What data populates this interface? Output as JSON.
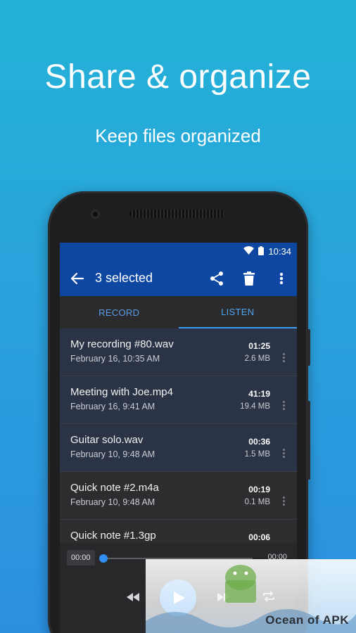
{
  "promo": {
    "headline": "Share & organize",
    "subline": "Keep files organized"
  },
  "status_bar": {
    "time": "10:34",
    "icons": [
      "wifi-icon",
      "battery-icon"
    ]
  },
  "toolbar": {
    "back_icon": "arrow-left-icon",
    "title": "3 selected",
    "actions": [
      "share-icon",
      "delete-icon",
      "more-vertical-icon"
    ]
  },
  "tabs": [
    {
      "label": "RECORD",
      "active": false
    },
    {
      "label": "LISTEN",
      "active": true
    }
  ],
  "recordings": [
    {
      "name": "My recording #80.wav",
      "date": "February 16, 10:35 AM",
      "duration": "01:25",
      "size": "2.6 MB",
      "selected": true
    },
    {
      "name": "Meeting with Joe.mp4",
      "date": "February 16, 9:41 AM",
      "duration": "41:19",
      "size": "19.4 MB",
      "selected": true
    },
    {
      "name": "Guitar solo.wav",
      "date": "February 10, 9:48 AM",
      "duration": "00:36",
      "size": "1.5 MB",
      "selected": true
    },
    {
      "name": "Quick note #2.m4a",
      "date": "February 10, 9:48 AM",
      "duration": "00:19",
      "size": "0.1 MB",
      "selected": false
    },
    {
      "name": "Quick note #1.3gp",
      "date": "",
      "duration": "00:06",
      "size": "",
      "selected": false
    }
  ],
  "player": {
    "current_time": "00:00",
    "total_time": "00:00",
    "progress": 0,
    "controls": [
      "rewind-icon",
      "play-icon",
      "fast-forward-icon",
      "repeat-icon"
    ]
  },
  "watermark": {
    "text": "Ocean of APK"
  },
  "colors": {
    "background_top": "#22b2d6",
    "background_bottom": "#2b8fe0",
    "app_bar": "#0d47a1",
    "accent": "#2a8ff2",
    "selected_row": "#2a3446"
  }
}
